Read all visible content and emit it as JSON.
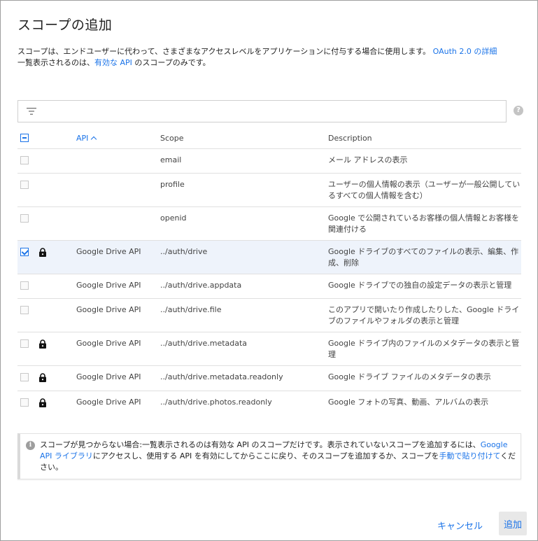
{
  "dialog": {
    "title": "スコープの追加",
    "description_line1": "スコープは、エンドユーザーに代わって、さまざまなアクセスレベルをアプリケーションに付与する場合に使用します。",
    "description_link1": "OAuth 2.0 の詳細",
    "description_line2_prefix": "一覧表示されるのは、",
    "description_link2": "有効な API",
    "description_line2_suffix": "のスコープのみです。"
  },
  "filter": {
    "placeholder": "",
    "icon": "filter-icon",
    "help_icon": "help-icon"
  },
  "table": {
    "columns": {
      "api": "API",
      "scope": "Scope",
      "description": "Description"
    },
    "sort": "api-ascending",
    "rows": [
      {
        "checked": false,
        "locked": false,
        "api": "",
        "scope": "email",
        "description": "メール アドレスの表示"
      },
      {
        "checked": false,
        "locked": false,
        "api": "",
        "scope": "profile",
        "description": "ユーザーの個人情報の表示（ユーザーが一般公開しているすべての個人情報を含む）"
      },
      {
        "checked": false,
        "locked": false,
        "api": "",
        "scope": "openid",
        "description": "Google で公開されているお客様の個人情報とお客様を関連付ける"
      },
      {
        "checked": true,
        "locked": true,
        "api": "Google Drive API",
        "scope": "../auth/drive",
        "description": "Google ドライブのすべてのファイルの表示、編集、作成、削除"
      },
      {
        "checked": false,
        "locked": false,
        "api": "Google Drive API",
        "scope": "../auth/drive.appdata",
        "description": "Google ドライブでの独自の設定データの表示と管理"
      },
      {
        "checked": false,
        "locked": false,
        "api": "Google Drive API",
        "scope": "../auth/drive.file",
        "description": "このアプリで開いたり作成したりした、Google ドライブのファイルやフォルダの表示と管理"
      },
      {
        "checked": false,
        "locked": true,
        "api": "Google Drive API",
        "scope": "../auth/drive.metadata",
        "description": "Google ドライブ内のファイルのメタデータの表示と管理"
      },
      {
        "checked": false,
        "locked": true,
        "api": "Google Drive API",
        "scope": "../auth/drive.metadata.readonly",
        "description": "Google ドライブ ファイルのメタデータの表示"
      },
      {
        "checked": false,
        "locked": true,
        "api": "Google Drive API",
        "scope": "../auth/drive.photos.readonly",
        "description": "Google フォトの写真、動画、アルバムの表示"
      }
    ]
  },
  "info": {
    "text1": "スコープが見つからない場合:一覧表示されるのは有効な API のスコープだけです。表示されていないスコープを追加するには、",
    "link1": "Google API ライブラリ",
    "text2": "にアクセスし、使用する API を有効にしてからここに戻り、そのスコープを追加するか、スコープを",
    "link2": "手動で貼り付けて",
    "text3": "ください。"
  },
  "buttons": {
    "cancel": "キャンセル",
    "add": "追加"
  },
  "colors": {
    "accent": "#1a73e8",
    "selected_row": "#eef3fb"
  }
}
